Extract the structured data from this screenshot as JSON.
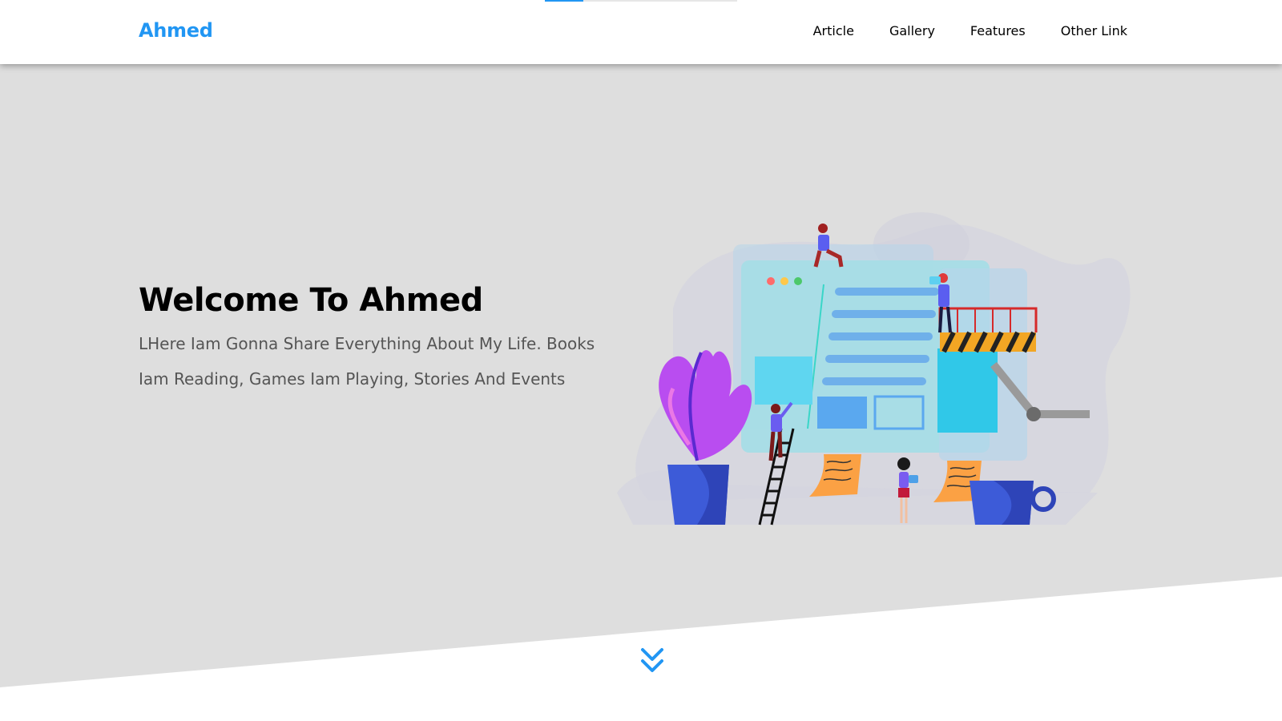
{
  "brand": {
    "name": "Ahmed",
    "accent_color": "#2196f3"
  },
  "nav": {
    "items": [
      {
        "label": "Article"
      },
      {
        "label": "Gallery"
      },
      {
        "label": "Features"
      },
      {
        "label": "Other Link"
      }
    ]
  },
  "scroll_progress": 0.2,
  "hero": {
    "title": "Welcome To Ahmed",
    "description": "LHere Iam Gonna Share Everything About My Life. Books Iam Reading, Games Iam Playing, Stories And Events",
    "background_color": "#dedede"
  },
  "icons": {
    "scroll": "double-chevron-down-icon"
  }
}
